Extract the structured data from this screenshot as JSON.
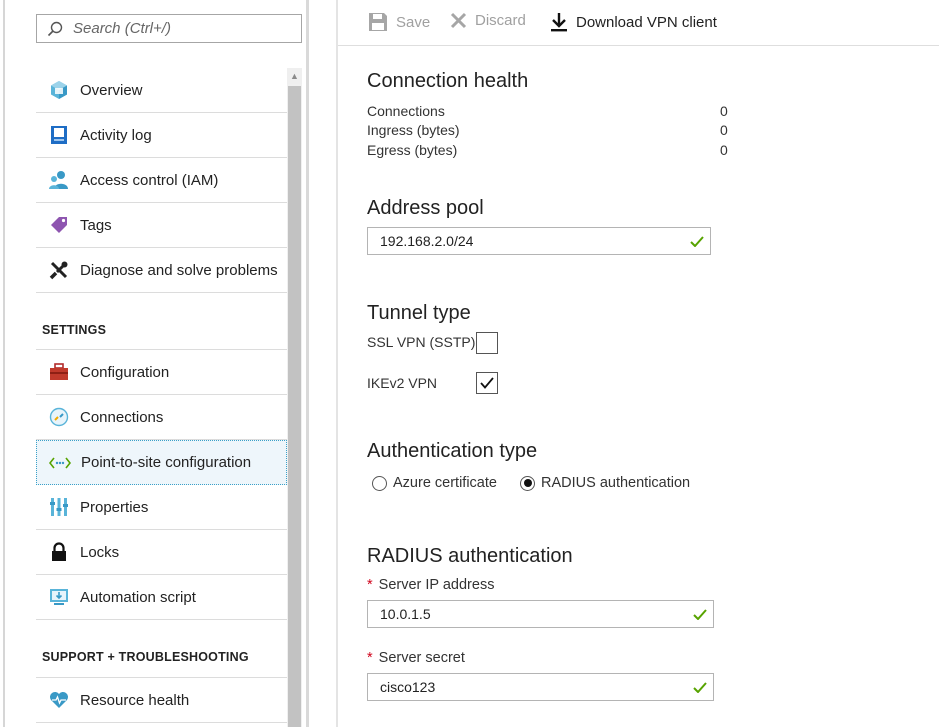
{
  "search": {
    "placeholder": "Search (Ctrl+/)"
  },
  "menu": {
    "items_top": [
      {
        "label": "Overview",
        "icon": "overview-icon"
      },
      {
        "label": "Activity log",
        "icon": "activity-log-icon"
      },
      {
        "label": "Access control (IAM)",
        "icon": "iam-icon"
      },
      {
        "label": "Tags",
        "icon": "tag-icon"
      },
      {
        "label": "Diagnose and solve problems",
        "icon": "wrench-icon"
      }
    ],
    "settings_header": "SETTINGS",
    "items_settings": [
      {
        "label": "Configuration",
        "icon": "toolbox-icon"
      },
      {
        "label": "Connections",
        "icon": "connections-icon"
      },
      {
        "label": "Point-to-site configuration",
        "icon": "point-to-site-icon",
        "active": true
      },
      {
        "label": "Properties",
        "icon": "properties-icon"
      },
      {
        "label": "Locks",
        "icon": "lock-icon"
      },
      {
        "label": "Automation script",
        "icon": "automation-script-icon"
      }
    ],
    "support_header": "SUPPORT + TROUBLESHOOTING",
    "items_support": [
      {
        "label": "Resource health",
        "icon": "heart-icon"
      }
    ]
  },
  "toolbar": {
    "save_label": "Save",
    "discard_label": "Discard",
    "download_label": "Download VPN client"
  },
  "connection_health": {
    "title": "Connection health",
    "rows": [
      {
        "label": "Connections",
        "value": "0"
      },
      {
        "label": "Ingress (bytes)",
        "value": "0"
      },
      {
        "label": "Egress (bytes)",
        "value": "0"
      }
    ]
  },
  "address_pool": {
    "title": "Address pool",
    "value": "192.168.2.0/24"
  },
  "tunnel_type": {
    "title": "Tunnel type",
    "options": [
      {
        "label": "SSL VPN (SSTP)",
        "checked": false
      },
      {
        "label": "IKEv2 VPN",
        "checked": true
      }
    ]
  },
  "auth_type": {
    "title": "Authentication type",
    "options": [
      {
        "label": "Azure certificate",
        "selected": false
      },
      {
        "label": "RADIUS authentication",
        "selected": true
      }
    ]
  },
  "radius": {
    "title": "RADIUS authentication",
    "server_ip_label": "Server IP address",
    "server_ip_value": "10.0.1.5",
    "server_secret_label": "Server secret",
    "server_secret_value": "cisco123",
    "required_marker": "*"
  },
  "colors": {
    "valid_check": "#57a300",
    "active_border": "#3aa0c8",
    "required_star": "#d0021b"
  }
}
